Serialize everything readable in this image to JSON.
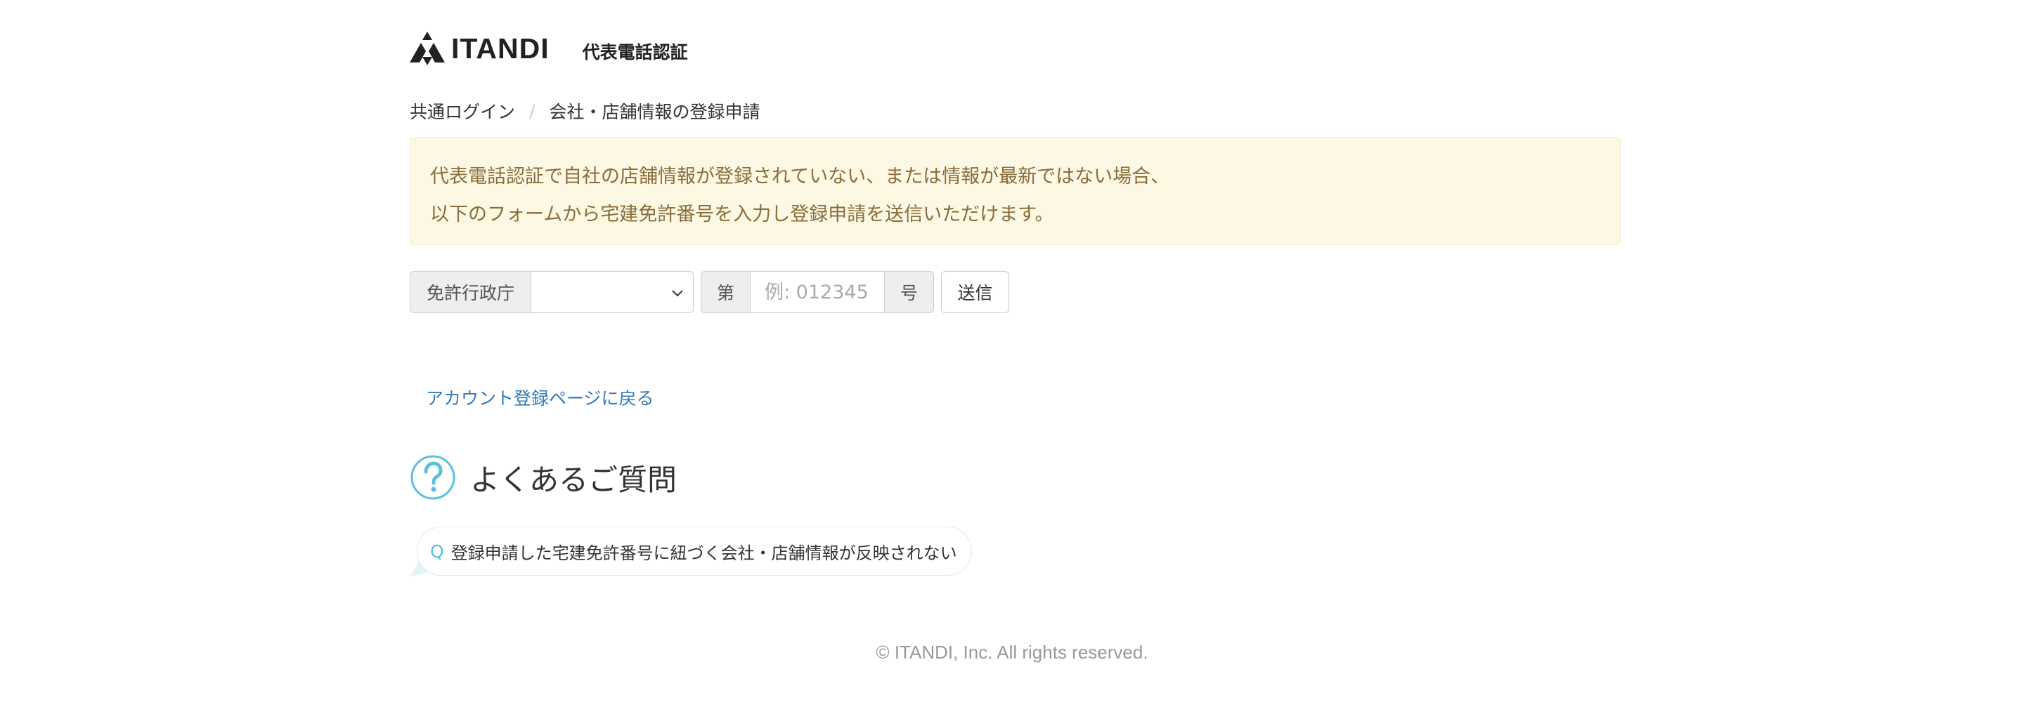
{
  "header": {
    "brand": "ITANDI",
    "subtitle": "代表電話認証"
  },
  "breadcrumb": {
    "items": [
      "共通ログイン",
      "会社・店舗情報の登録申請"
    ],
    "separator": "/"
  },
  "notice": {
    "lines": [
      "代表電話認証で自社の店舗情報が登録されていない、または情報が最新ではない場合、",
      "以下のフォームから宅建免許番号を入力し登録申請を送信いただけます。"
    ]
  },
  "form": {
    "authority_label": "免許行政庁",
    "authority_selected": "",
    "number_prefix": "第",
    "number_placeholder": "例: 012345",
    "number_value": "",
    "number_suffix": "号",
    "submit_label": "送信"
  },
  "back_link": "アカウント登録ページに戻る",
  "faq": {
    "title": "よくあるご質問",
    "icon": "question-circle-icon",
    "items": [
      {
        "marker": "Q",
        "question": "登録申請した宅建免許番号に紐づく会社・店舗情報が反映されない"
      }
    ]
  },
  "footer": "© ITANDI, Inc. All rights reserved.",
  "colors": {
    "link": "#337ab7",
    "notice_bg": "#fcf8e3",
    "notice_text": "#8a6d3b",
    "faq_accent": "#5bc0de"
  }
}
